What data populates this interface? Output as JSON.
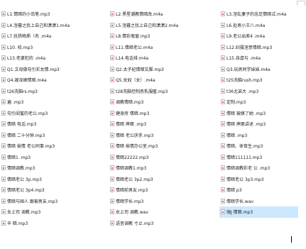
{
  "window": {},
  "files": [
    {
      "name": "L1.情暗的小岛笔.mp3"
    },
    {
      "name": "L2.黑星潮教情暗改.m4a"
    },
    {
      "name": "L3.涅乱妻子的念足情暗试.m4a"
    },
    {
      "name": "L4.涅暮之犹上自己和潇潇1.m4a"
    },
    {
      "name": "L5.涅暮之犹上自己和潇潇2.m4a"
    },
    {
      "name": "L6.处男小王八.m4a"
    },
    {
      "name": "L7.扰扬物质（名                    .m4a"
    },
    {
      "name": "L8.情彩瓶窗.mp3"
    },
    {
      "name": "L9.老公出差4            .m4a"
    },
    {
      "name": "L10.            校.mp3"
    },
    {
      "name": "L11.情暗老公.m4a"
    },
    {
      "name": "L12.妇摄涅意情暗.mp3"
    },
    {
      "name": "L13.老婆犯的            .m4a"
    },
    {
      "name": "L14.电话排.m4a"
    },
    {
      "name": "L15.自虐与            .m4a"
    },
    {
      "name": "Q1.文母做勾引实女情.mp3"
    },
    {
      "name": "Q2.太子妃情暗又脚.mp3"
    },
    {
      "name": "Q3.玩男同学妹妹.m4a"
    },
    {
      "name": "Q4.被深嫁情暗.m4a"
    },
    {
      "name": "Q5.女奴（女）.m4a"
    },
    {
      "name": "t25洗脑rush.mp3"
    },
    {
      "name": "t26洗脑rs.mp3"
    },
    {
      "name": "t28洗脑控制恶乳服匿.mp3"
    },
    {
      "name": "t36尤弟大            .mp3"
    },
    {
      "name": "遍            .mp3"
    },
    {
      "name": "调教情暗.mp3"
    },
    {
      "name": "定制.mp3"
    },
    {
      "name": "勾引闺蜜的老公.mp3"
    },
    {
      "name": "健身房 情暗.mp3"
    },
    {
      "name": "情暗 被嫁了她            .mp3"
    },
    {
      "name": "情暗 电话.mp3"
    },
    {
      "name": "情暗 摔面            .mp3"
    },
    {
      "name": "情暗 摔面讲述            .mp3"
    },
    {
      "name": "情暗          二十分钟.mp3"
    },
    {
      "name": "情暗 老公厌手.mp3"
    },
    {
      "name": "情暗            .mp3"
    },
    {
      "name": "情暗 偷情 老公同事.mp3"
    },
    {
      "name": "情暗 偷情办公室.mp3"
    },
    {
      "name": "情暗、体育生.mp3"
    },
    {
      "name": "情暗1            .mp3"
    },
    {
      "name": "情暗22222.mp3"
    },
    {
      "name": "情暗111111.mp3"
    },
    {
      "name": "情暗调教.mp3"
    },
    {
      "name": "情暗调教1.mp3"
    },
    {
      "name": "情暗调教彩老 公            .mp3"
    },
    {
      "name": "情暗老公 3p.mp3"
    },
    {
      "name": "情暗老公 3p2.mp3"
    },
    {
      "name": "情暗老公 3p3.mp3"
    },
    {
      "name": "情暗老公 3p4.mp3"
    },
    {
      "name": "情暗前男友.mp3"
    },
    {
      "name": "情暗            p3"
    },
    {
      "name": "情暗与国人 跟被男友.mp3"
    },
    {
      "name": "情暗学长.mp3"
    },
    {
      "name": "情暗学长.wav"
    },
    {
      "name": "女上司 调教.mp3"
    },
    {
      "name": "女上司 调教.wav"
    },
    {
      "name": "强J 情暗.mp3",
      "selected": true
    },
    {
      "name": "辛            暗.mp3"
    },
    {
      "name": "语音调教 寸止.mp3"
    }
  ]
}
